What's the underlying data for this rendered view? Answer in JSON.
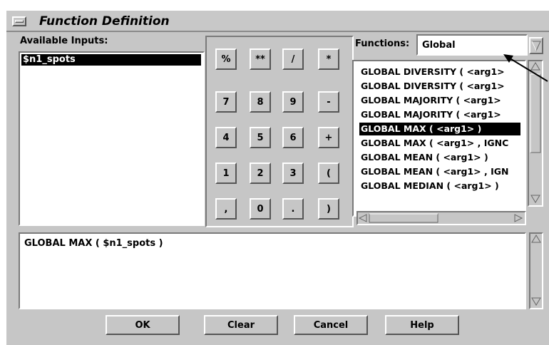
{
  "window": {
    "title": "Function Definition"
  },
  "available_inputs": {
    "label": "Available Inputs:",
    "items": [
      "$n1_spots"
    ],
    "selected": "$n1_spots"
  },
  "keypad": {
    "rows": [
      [
        "%",
        "**",
        "/",
        "*"
      ],
      [
        "7",
        "8",
        "9",
        "-"
      ],
      [
        "4",
        "5",
        "6",
        "+"
      ],
      [
        "1",
        "2",
        "3",
        "("
      ],
      [
        ",",
        "0",
        ".",
        ")"
      ]
    ]
  },
  "functions": {
    "label": "Functions:",
    "category_value": "Global",
    "items": [
      "GLOBAL DIVERSITY ( <arg1>",
      "GLOBAL DIVERSITY ( <arg1>",
      "GLOBAL MAJORITY ( <arg1>",
      "GLOBAL MAJORITY ( <arg1>",
      "GLOBAL MAX ( <arg1> )",
      "GLOBAL MAX ( <arg1> , IGNC",
      "GLOBAL MEAN ( <arg1> )",
      "GLOBAL MEAN ( <arg1> , IGN",
      "GLOBAL MEDIAN ( <arg1> )"
    ],
    "selected_index": 4
  },
  "formula": {
    "text": "GLOBAL MAX ( $n1_spots )"
  },
  "buttons": {
    "ok": "OK",
    "clear": "Clear",
    "cancel": "Cancel",
    "help": "Help"
  }
}
